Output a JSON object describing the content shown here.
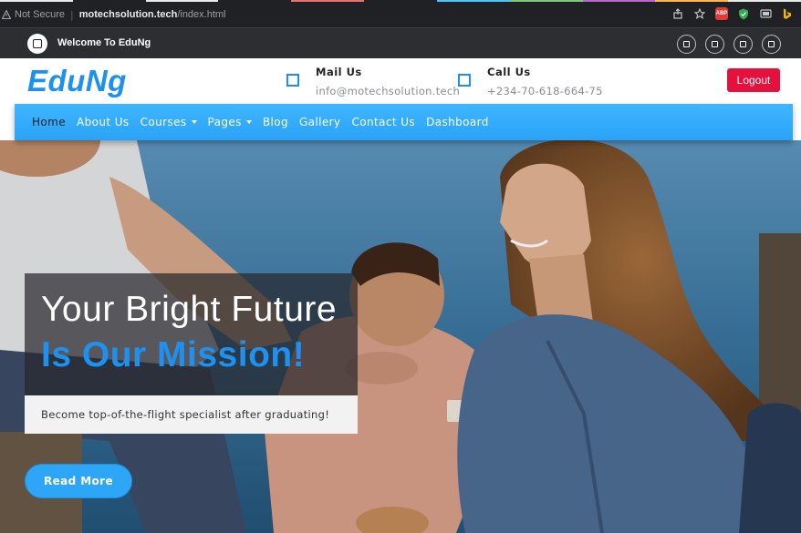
{
  "browser": {
    "security_label": "Not Secure",
    "url_host": "motechsolution.tech",
    "url_path": "/index.html",
    "icons": [
      "share-icon",
      "star-icon",
      "adblock-icon",
      "shield-extension-icon",
      "cast-icon",
      "bing-icon"
    ],
    "adblock_label": "ABP"
  },
  "topbar": {
    "title": "Welcome To EduNg",
    "social_icons": [
      "social-icon-1",
      "social-icon-2",
      "social-icon-3",
      "social-icon-4"
    ]
  },
  "header": {
    "brand": "EduNg",
    "mail_title": "Mail Us",
    "mail_value": "info@motechsolution.tech",
    "call_title": "Call Us",
    "call_value": "+234-70-618-664-75",
    "logout_label": "Logout"
  },
  "nav": {
    "items": [
      {
        "label": "Home",
        "active": true,
        "dropdown": false
      },
      {
        "label": "About Us",
        "active": false,
        "dropdown": false
      },
      {
        "label": "Courses",
        "active": false,
        "dropdown": true
      },
      {
        "label": "Pages",
        "active": false,
        "dropdown": true
      },
      {
        "label": "Blog",
        "active": false,
        "dropdown": false
      },
      {
        "label": "Gallery",
        "active": false,
        "dropdown": false
      },
      {
        "label": "Contact Us",
        "active": false,
        "dropdown": false
      },
      {
        "label": "Dashboard",
        "active": false,
        "dropdown": false
      }
    ]
  },
  "hero": {
    "headline_line1": "Your Bright Future",
    "headline_line2": "Is Our Mission!",
    "subtitle": "Become top-of-the-flight specialist after graduating!",
    "cta_label": "Read More"
  },
  "colors": {
    "accent": "#1e90ef",
    "nav_bg": "#2aa3f7",
    "logout": "#e5103e",
    "topbar": "#2d2e32"
  }
}
